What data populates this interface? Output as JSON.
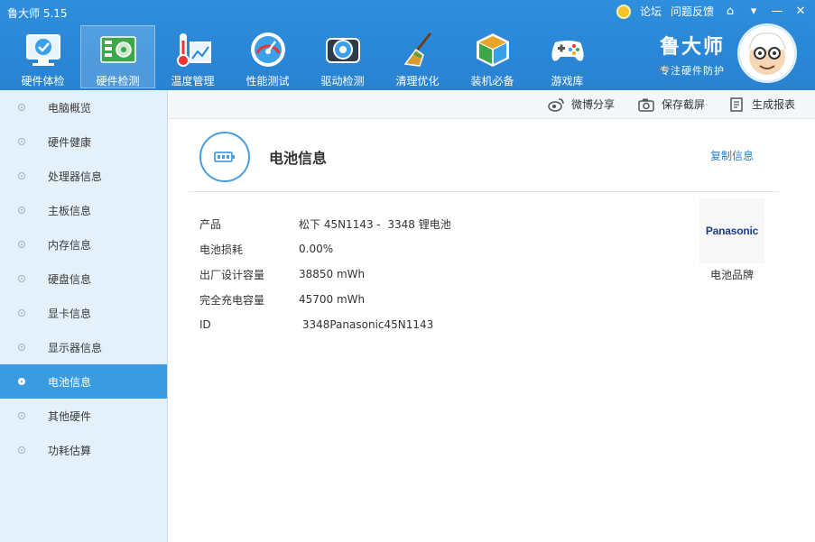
{
  "app": {
    "title": "鲁大师 5.15"
  },
  "window_links": {
    "forum": "论坛",
    "feedback": "问题反馈"
  },
  "nav": [
    {
      "label": "硬件体检",
      "icon": "monitor-check-icon"
    },
    {
      "label": "硬件检测",
      "icon": "hardware-board-icon",
      "active": true
    },
    {
      "label": "温度管理",
      "icon": "thermometer-icon"
    },
    {
      "label": "性能测试",
      "icon": "speedometer-icon"
    },
    {
      "label": "驱动检测",
      "icon": "driver-gear-icon"
    },
    {
      "label": "清理优化",
      "icon": "broom-icon"
    },
    {
      "label": "装机必备",
      "icon": "package-cube-icon"
    },
    {
      "label": "游戏库",
      "icon": "gamepad-icon"
    }
  ],
  "brand": {
    "name": "鲁大师",
    "slogan": "专注硬件防护"
  },
  "sidebar": {
    "items": [
      {
        "label": "电脑概览"
      },
      {
        "label": "硬件健康"
      },
      {
        "label": "处理器信息"
      },
      {
        "label": "主板信息"
      },
      {
        "label": "内存信息"
      },
      {
        "label": "硬盘信息"
      },
      {
        "label": "显卡信息"
      },
      {
        "label": "显示器信息"
      },
      {
        "label": "电池信息",
        "active": true
      },
      {
        "label": "其他硬件"
      },
      {
        "label": "功耗估算"
      }
    ]
  },
  "toolbar": {
    "weibo_share": "微博分享",
    "save_screenshot": "保存截屏",
    "generate_report": "生成报表"
  },
  "main": {
    "title": "电池信息",
    "copy_info": "复制信息",
    "rows": [
      {
        "key": "产品",
        "value": "松下 45N1143 -  3348 锂电池"
      },
      {
        "key": "电池损耗",
        "value": "0.00%"
      },
      {
        "key": "出厂设计容量",
        "value": "38850 mWh"
      },
      {
        "key": "完全充电容量",
        "value": "45700 mWh"
      },
      {
        "key": "ID",
        "value": " 3348Panasonic45N1143"
      }
    ],
    "brand_logo_text": "Panasonic",
    "brand_caption": "电池品牌"
  },
  "colors": {
    "topbar": "#2a86d6",
    "accent": "#3a9be0",
    "sidebar_bg": "#e4f1fa",
    "link": "#2a7fd0"
  }
}
